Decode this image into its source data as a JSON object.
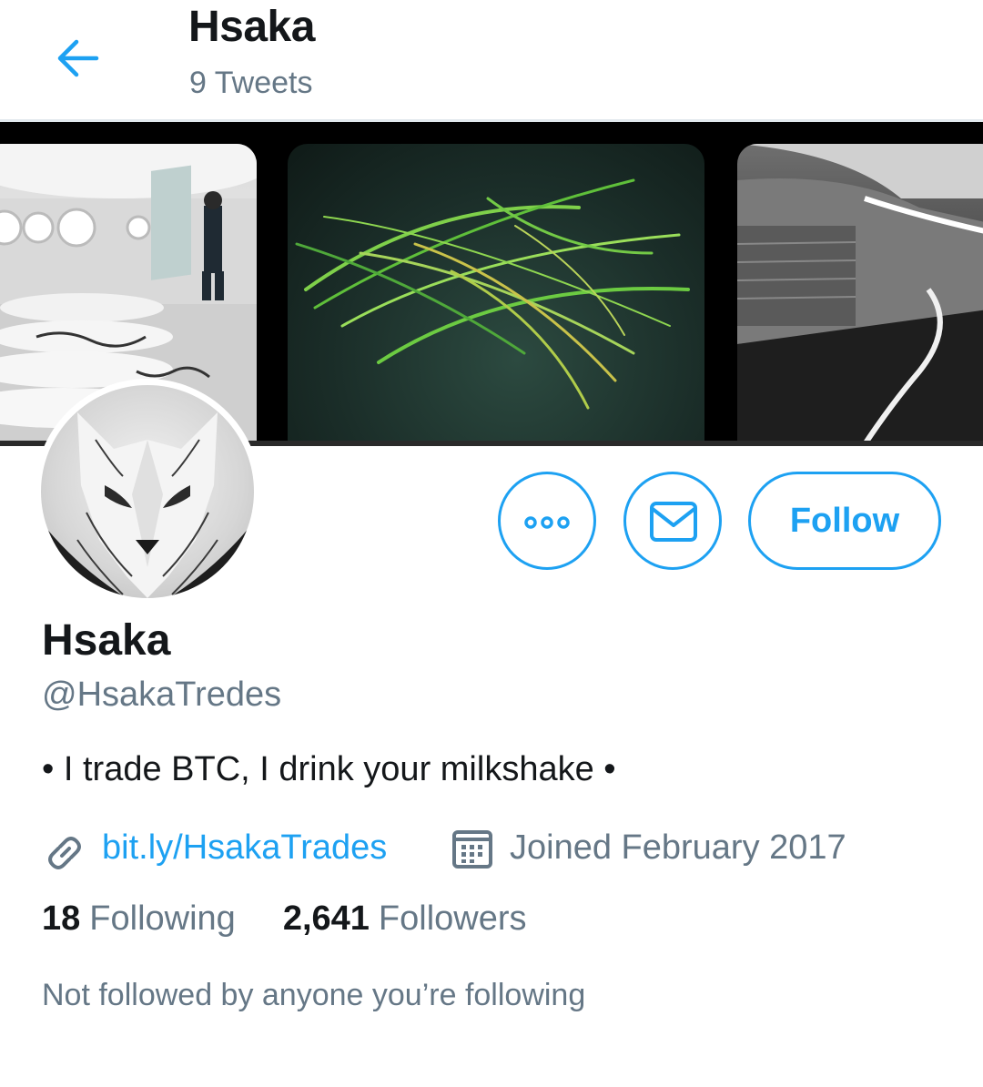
{
  "header": {
    "back_icon": "arrow-left-icon",
    "title": "Hsaka",
    "tweet_count": "9 Tweets"
  },
  "actions": {
    "more_icon": "more-options-icon",
    "message_icon": "mail-icon",
    "follow_label": "Follow"
  },
  "profile": {
    "name": "Hsaka",
    "handle": "@HsakaTredes",
    "bio": "• I trade BTC, I drink your milkshake •",
    "link": "bit.ly/HsakaTrades",
    "joined": "Joined February 2017",
    "following_count": "18",
    "following_label": "Following",
    "followers_count": "2,641",
    "followers_label": "Followers",
    "not_followed_text": "Not followed by anyone you’re following"
  },
  "colors": {
    "accent": "#1da1f2",
    "secondary_text": "#657786",
    "primary_text": "#14171a"
  }
}
